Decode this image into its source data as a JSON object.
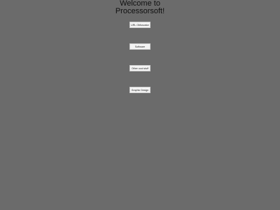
{
  "header": {
    "title_line1": "Welcome to",
    "title_line2": "Processorsoft!"
  },
  "menu": {
    "items": [
      {
        "label": "URL Obfuscator"
      },
      {
        "label": "Software"
      },
      {
        "label": "Other cool stuff"
      },
      {
        "label": "Graphic Design"
      }
    ]
  },
  "colors": {
    "background": "#6b6b6b",
    "button_bg": "#f4f4f4",
    "text": "#101010"
  }
}
